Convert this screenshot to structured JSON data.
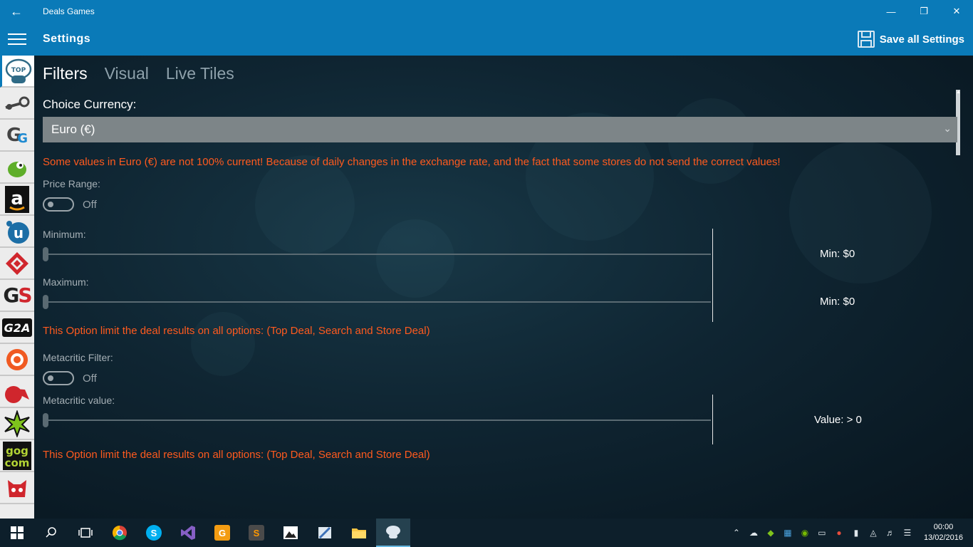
{
  "window": {
    "title": "Deals Games"
  },
  "header": {
    "page_title": "Settings",
    "save_label": "Save all Settings"
  },
  "sidebar": {
    "stores": [
      "top-deals",
      "steam",
      "greenmangaming",
      "gamersgate-dragon",
      "amazon",
      "uplay",
      "humble",
      "gamestop",
      "g2a",
      "origin",
      "gamefly",
      "gamesplanet",
      "gog",
      "other"
    ]
  },
  "tabs": [
    {
      "label": "Filters",
      "active": true
    },
    {
      "label": "Visual",
      "active": false
    },
    {
      "label": "Live Tiles",
      "active": false
    }
  ],
  "currency": {
    "label": "Choice Currency:",
    "selected": "Euro (€)",
    "warning": "Some values in Euro (€) are not 100% current! Because of daily changes in the exchange rate, and the fact that some stores do not send the correct values!"
  },
  "price_range": {
    "label": "Price Range:",
    "toggle_state": "Off",
    "minimum_label": "Minimum:",
    "minimum_value": "Min: $0",
    "maximum_label": "Maximum:",
    "maximum_value": "Min: $0",
    "note": "This Option limit the deal results on all options: (Top Deal, Search and Store Deal)"
  },
  "metacritic": {
    "label": "Metacritic Filter:",
    "toggle_state": "Off",
    "value_label": "Metacritic value:",
    "value_text": "Value: > 0",
    "note": "This Option limit the deal results on all options: (Top Deal, Search and Store Deal)"
  },
  "taskbar": {
    "apps": [
      "start",
      "search",
      "task-view",
      "chrome",
      "skype",
      "visual-studio",
      "pdf",
      "sublime",
      "photos",
      "paint",
      "file-explorer",
      "deals-games"
    ],
    "time": "00:00",
    "date": "13/02/2016"
  },
  "colors": {
    "accent": "#0a7ab8",
    "warning": "#ff5a1e"
  }
}
